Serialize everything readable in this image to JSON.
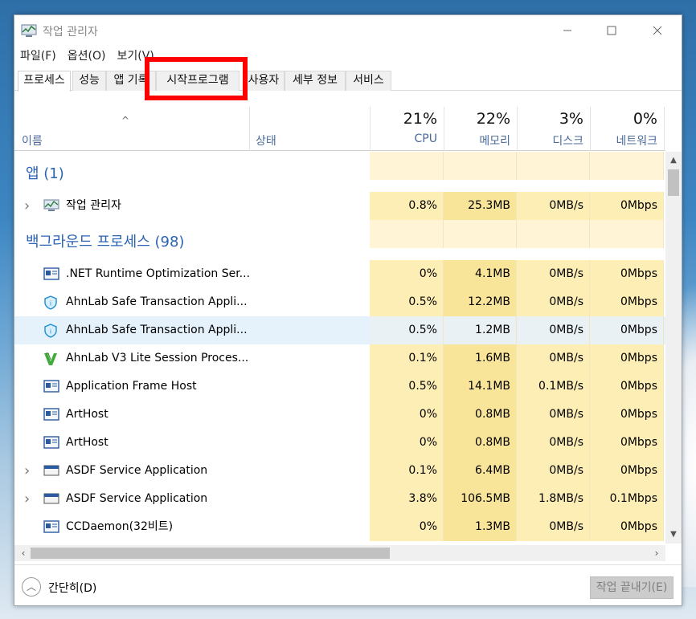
{
  "window": {
    "title": "작업 관리자",
    "minimize": "—",
    "maximize": "☐",
    "close": "✕"
  },
  "menu": [
    "파일(F)",
    "옵션(O)",
    "보기(V)"
  ],
  "tabs": [
    "프로세스",
    "성능",
    "앱 기록",
    "시작프로그램",
    "사용자",
    "세부 정보",
    "서비스"
  ],
  "columns": {
    "sort_indicator": "^",
    "name": "이름",
    "status": "상태",
    "cpu": {
      "pct": "21%",
      "label": "CPU"
    },
    "memory": {
      "pct": "22%",
      "label": "메모리"
    },
    "disk": {
      "pct": "3%",
      "label": "디스크"
    },
    "network": {
      "pct": "0%",
      "label": "네트워크"
    }
  },
  "groups": {
    "apps": "앱 (1)",
    "background": "백그라운드 프로세스 (98)"
  },
  "apps": [
    {
      "name": "작업 관리자",
      "cpu": "0.8%",
      "mem": "25.3MB",
      "disk": "0MB/s",
      "net": "0Mbps",
      "icon": "task-manager-icon",
      "expandable": true
    }
  ],
  "processes": [
    {
      "name": ".NET Runtime Optimization Ser...",
      "cpu": "0%",
      "mem": "4.1MB",
      "disk": "0MB/s",
      "net": "0Mbps",
      "icon": "window-app-icon",
      "expandable": false
    },
    {
      "name": "AhnLab Safe Transaction Appli...",
      "cpu": "0.5%",
      "mem": "12.2MB",
      "disk": "0MB/s",
      "net": "0Mbps",
      "icon": "shield-icon",
      "expandable": false
    },
    {
      "name": "AhnLab Safe Transaction Appli...",
      "cpu": "0.5%",
      "mem": "1.2MB",
      "disk": "0MB/s",
      "net": "0Mbps",
      "icon": "shield-icon",
      "expandable": false,
      "hover": true
    },
    {
      "name": "AhnLab V3 Lite Session Proces...",
      "cpu": "0.1%",
      "mem": "1.6MB",
      "disk": "0MB/s",
      "net": "0Mbps",
      "icon": "v3-icon",
      "expandable": false
    },
    {
      "name": "Application Frame Host",
      "cpu": "0.5%",
      "mem": "14.1MB",
      "disk": "0.1MB/s",
      "net": "0Mbps",
      "icon": "window-app-icon",
      "expandable": false
    },
    {
      "name": "ArtHost",
      "cpu": "0%",
      "mem": "0.8MB",
      "disk": "0MB/s",
      "net": "0Mbps",
      "icon": "window-app-icon",
      "expandable": false
    },
    {
      "name": "ArtHost",
      "cpu": "0%",
      "mem": "0.8MB",
      "disk": "0MB/s",
      "net": "0Mbps",
      "icon": "window-app-icon",
      "expandable": false
    },
    {
      "name": "ASDF Service Application",
      "cpu": "0.1%",
      "mem": "6.4MB",
      "disk": "0MB/s",
      "net": "0Mbps",
      "icon": "service-app-icon",
      "expandable": true
    },
    {
      "name": "ASDF Service Application",
      "cpu": "3.8%",
      "mem": "106.5MB",
      "disk": "1.8MB/s",
      "net": "0.1Mbps",
      "icon": "service-app-icon",
      "expandable": true
    },
    {
      "name": "CCDaemon(32비트)",
      "cpu": "0%",
      "mem": "1.3MB",
      "disk": "0MB/s",
      "net": "0Mbps",
      "icon": "window-app-icon",
      "expandable": false
    }
  ],
  "footer": {
    "collapse": "간단히(D)",
    "end_task": "작업 끝내기(E)"
  },
  "colors": {
    "usage_light": "#fff4d6",
    "usage_mid": "#fdeeb6",
    "usage_dark": "#f9e59a",
    "group_text": "#2b63b5",
    "highlight_box": "#ff0000"
  }
}
